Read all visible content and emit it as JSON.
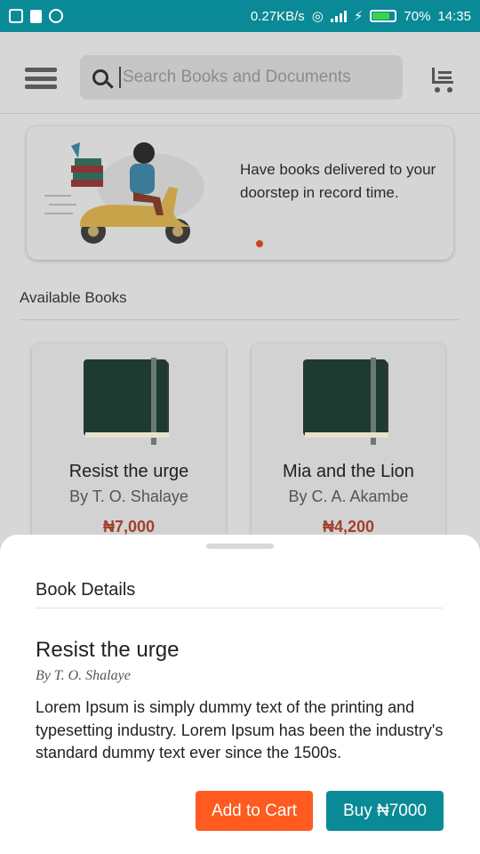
{
  "status_bar": {
    "speed": "0.27KB/s",
    "battery": "70%",
    "time": "14:35"
  },
  "topbar": {
    "search_placeholder": "Search Books and Documents"
  },
  "banner": {
    "text": "Have books delivered to your doorstep in record time."
  },
  "section": {
    "title": "Available Books"
  },
  "books": [
    {
      "title": "Resist the urge",
      "author": "By T. O. Shalaye",
      "price": "₦7,000"
    },
    {
      "title": "Mia and the Lion",
      "author": "By C. A. Akambe",
      "price": "₦4,200"
    }
  ],
  "sheet": {
    "header": "Book Details",
    "title": "Resist the urge",
    "author": "By T. O. Shalaye",
    "description": "Lorem Ipsum is simply dummy text of the printing and typesetting industry. Lorem Ipsum has been the industry's standard dummy text ever since the 1500s.",
    "add_to_cart": "Add to Cart",
    "buy": "Buy ₦7000"
  },
  "colors": {
    "status_bar": "#0a8a96",
    "accent_orange": "#ff5a1f",
    "accent_teal": "#0a8a96",
    "price": "#a3402a"
  }
}
